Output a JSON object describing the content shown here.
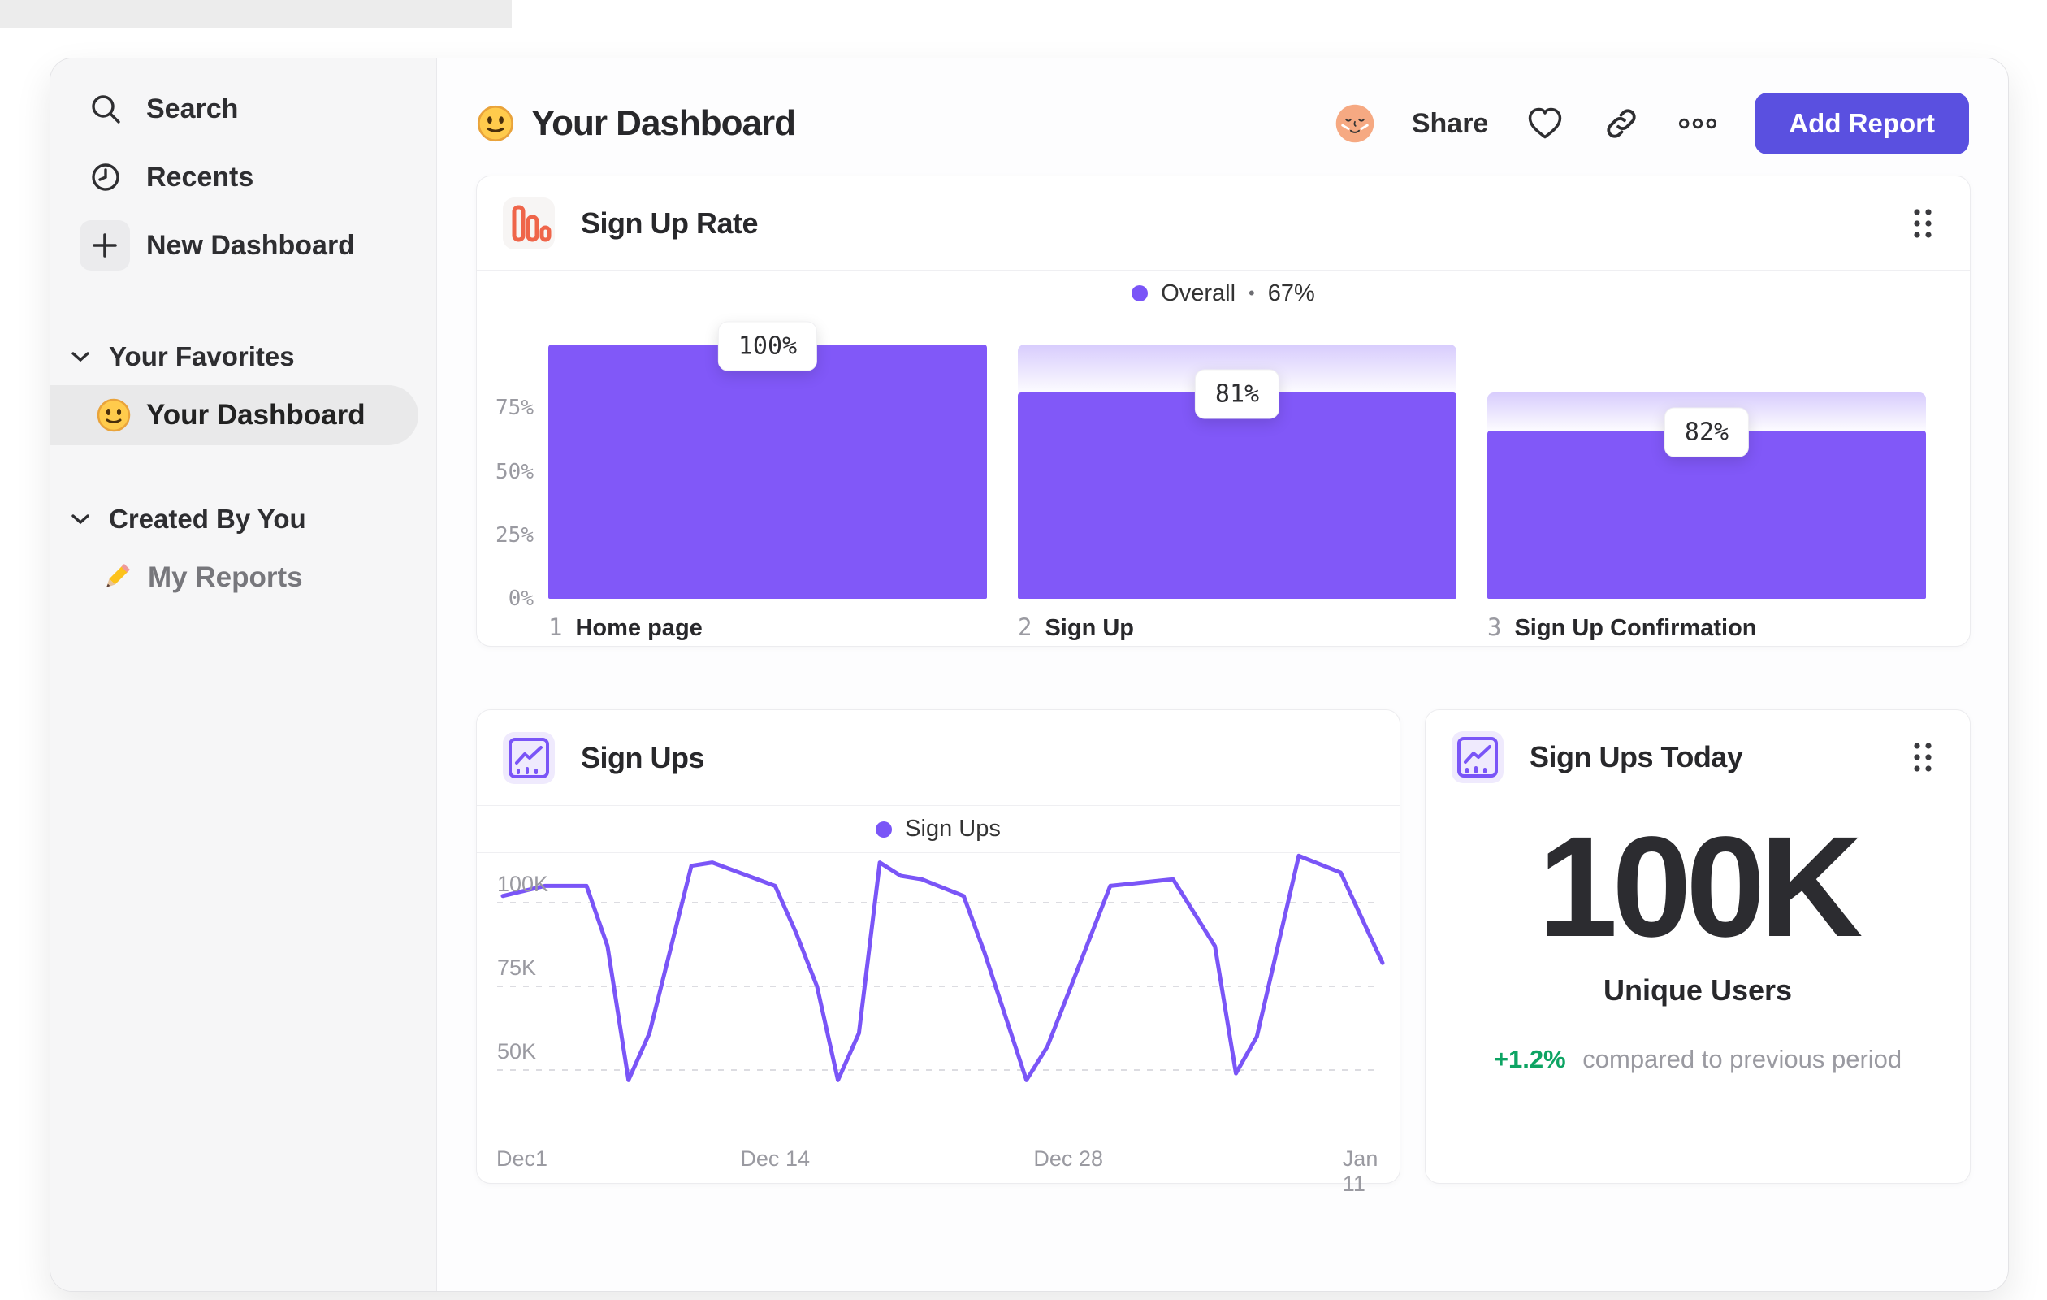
{
  "colors": {
    "accent_purple": "#7a55f7",
    "bar_purple": "#8158f8",
    "button_indigo": "#5a50e0",
    "funnel_icon_orange": "#ef654a",
    "delta_green": "#0da463"
  },
  "sidebar": {
    "items": [
      {
        "icon": "search-icon",
        "label": "Search"
      },
      {
        "icon": "clock-icon",
        "label": "Recents"
      },
      {
        "icon": "plus-icon",
        "label": "New Dashboard"
      }
    ],
    "sections": [
      {
        "label": "Your Favorites",
        "items": [
          {
            "icon": "smiley-emoji",
            "label": "Your Dashboard",
            "selected": true
          }
        ]
      },
      {
        "label": "Created By You",
        "items": [
          {
            "icon": "pencil-emoji",
            "label": "My Reports",
            "selected": false
          }
        ]
      }
    ]
  },
  "header": {
    "emoji": "smiley-emoji",
    "title": "Your Dashboard",
    "share_label": "Share",
    "icons": [
      "avatar",
      "heart-icon",
      "link-icon",
      "more-icon"
    ],
    "add_report_label": "Add Report"
  },
  "cards": {
    "funnel": {
      "title": "Sign Up Rate",
      "legend": {
        "label": "Overall",
        "separator": "•",
        "value": "67%"
      }
    },
    "line": {
      "title": "Sign Ups",
      "legend": {
        "label": "Sign Ups"
      }
    },
    "metric": {
      "title": "Sign Ups Today",
      "value": "100K",
      "label": "Unique Users",
      "delta": "+1.2%",
      "delta_caption": "compared to previous period"
    }
  },
  "chart_data": [
    {
      "type": "bar",
      "title": "Sign Up Rate",
      "subtype": "funnel",
      "categories": [
        "Home page",
        "Sign Up",
        "Sign Up Confirmation"
      ],
      "step_numbers": [
        "1",
        "2",
        "3"
      ],
      "step_conversion_pct": [
        100,
        81,
        82
      ],
      "cumulative_pct": [
        100,
        81,
        66
      ],
      "labels": [
        "100%",
        "81%",
        "82%"
      ],
      "legend": "Overall • 67%",
      "overall_conversion": "67%",
      "ylim": [
        0,
        100
      ],
      "yticks": [
        {
          "v": 75,
          "label": "75%"
        },
        {
          "v": 50,
          "label": "50%"
        },
        {
          "v": 25,
          "label": "25%"
        },
        {
          "v": 0,
          "label": "0%"
        }
      ],
      "grid": false,
      "legend_position": "top-center"
    },
    {
      "type": "line",
      "title": "Sign Ups",
      "series": [
        {
          "name": "Sign Ups",
          "points_day_value_k": [
            [
              0,
              102
            ],
            [
              2,
              105
            ],
            [
              4,
              105
            ],
            [
              5,
              87
            ],
            [
              6,
              47
            ],
            [
              7,
              61
            ],
            [
              9,
              111
            ],
            [
              10,
              112
            ],
            [
              13,
              105
            ],
            [
              14,
              91
            ],
            [
              15,
              75
            ],
            [
              16,
              47
            ],
            [
              17,
              61
            ],
            [
              18,
              112
            ],
            [
              19,
              108
            ],
            [
              20,
              107
            ],
            [
              22,
              102
            ],
            [
              23,
              85
            ],
            [
              25,
              47
            ],
            [
              26,
              57
            ],
            [
              29,
              105
            ],
            [
              32,
              107
            ],
            [
              34,
              87
            ],
            [
              35,
              49
            ],
            [
              36,
              60
            ],
            [
              38,
              114
            ],
            [
              40,
              109
            ],
            [
              42,
              82
            ]
          ]
        }
      ],
      "x_range_days": [
        0,
        42
      ],
      "xticks": [
        {
          "day": 0,
          "label": "Dec1",
          "align": "left"
        },
        {
          "day": 13,
          "label": "Dec 14",
          "align": "center"
        },
        {
          "day": 27,
          "label": "Dec 28",
          "align": "center"
        },
        {
          "day": 41,
          "label": "Jan 11",
          "align": "center"
        }
      ],
      "yticks": [
        {
          "v": 100,
          "label": "100K"
        },
        {
          "v": 75,
          "label": "75K"
        },
        {
          "v": 50,
          "label": "50K"
        }
      ],
      "ylabel_unit": "K",
      "grid": "dashed-horizontal",
      "legend_position": "top-center"
    }
  ]
}
